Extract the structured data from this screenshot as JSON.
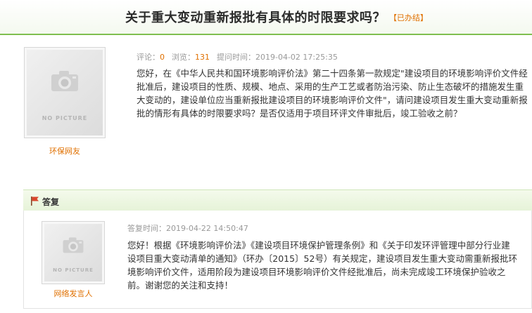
{
  "header": {
    "title": "关于重大变动重新报批有具体的时限要求吗？",
    "status": "【已办结】"
  },
  "question": {
    "avatar_text": "NO PICTURE",
    "author": "环保网友",
    "comments_label": "评论：",
    "comments_count": "0",
    "views_label": "浏览：",
    "views_count": "131",
    "time_label": "提问时间：",
    "time": "2019-04-02 17:25:35",
    "lines": [
      "您好，在《中华人民共和国环境影响评价法》第二十四条第一款规定\"建设项目的环境影响评价文件经",
      "批准后，建设项目的性质、规模、地点、采用的生产工艺或者防治污染、防止生态破坏的措施发生重",
      "大变动的，建设单位应当重新报批建设项目的环境影响评价文件\"，请问建设项目发生重大变动重新报",
      "批的情形有具体的时限要求吗？是否仅适用于项目环评文件审批后，竣工验收之前？"
    ]
  },
  "reply_section": {
    "label": "答复"
  },
  "answer": {
    "avatar_text": "NO PICTURE",
    "author": "网络发言人",
    "time_label": "答复时间：",
    "time": "2019-04-22 14:50:47",
    "lines": [
      "您好！根据《环境影响评价法》《建设项目环境保护管理条例》和《关于印发环评管理中部分行业建",
      "设项目重大变动清单的通知》（环办〔2015〕52号）有关规定，建设项目发生重大变动需重新报批环",
      "境影响评价文件，适用阶段为建设项目环境影响评价文件经批准后，尚未完成竣工环境保护验收之",
      "前。谢谢您的关注和支持！"
    ]
  },
  "colors": {
    "accent_orange": "#e07000",
    "green_rule": "#7fbf4f",
    "flag_red": "#d9452b"
  }
}
